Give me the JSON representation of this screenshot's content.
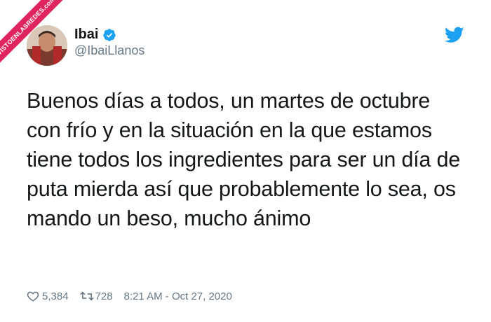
{
  "watermark": {
    "text": "VISTOENLASREDES.com"
  },
  "tweet": {
    "display_name": "Ibai",
    "handle": "@IbaiLlanos",
    "verified": true,
    "text": "Buenos días a todos, un martes de octubre con frío y en la situación en la que estamos tiene todos los ingredientes para ser un día de puta mierda así que probablemente lo sea, os mando un beso, mucho ánimo",
    "likes": "5,384",
    "retweets": "728",
    "timestamp": "8:21 AM - Oct 27, 2020"
  },
  "colors": {
    "twitter_blue": "#1da1f2",
    "secondary_text": "#657786",
    "ribbon": "#e0245e"
  },
  "icons": [
    "twitter-bird-icon",
    "verified-badge-icon",
    "heart-icon",
    "retweet-icon"
  ]
}
